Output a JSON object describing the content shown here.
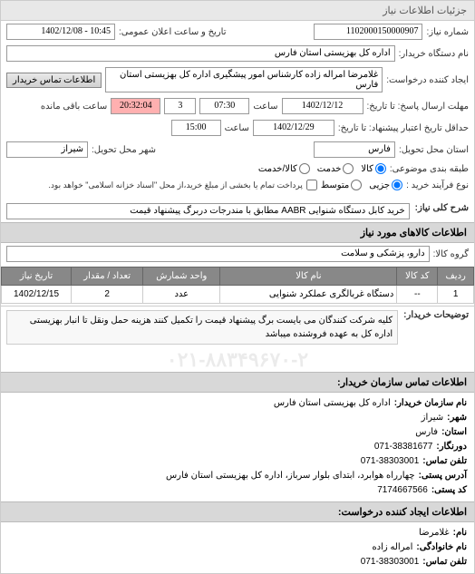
{
  "header": {
    "title": "جزئیات اطلاعات نیاز"
  },
  "form": {
    "needNumberLabel": "شماره نیاز:",
    "needNumber": "1102000150000907",
    "publicDateLabel": "تاریخ و ساعت اعلان عمومی:",
    "publicDate": "10:45 - 1402/12/08",
    "buyerOrgLabel": "نام دستگاه خریدار:",
    "buyerOrg": "اداره کل بهزیستی استان فارس",
    "requesterLabel": "ایجاد کننده درخواست:",
    "requester": "غلامرضا امراله زاده کارشناس امور پیشگیری اداره کل بهزیستی استان فارس",
    "contactBtn": "اطلاعات تماس خریدار",
    "deadlineLabel": "مهلت ارسال پاسخ: تا تاریخ:",
    "deadlineDate": "1402/12/12",
    "timeLabel": "ساعت",
    "deadlineTime": "07:30",
    "extCount": "3",
    "countdownLabel": "ساعت باقی مانده",
    "countdown": "20:32:04",
    "validityLabel": "حداقل تاریخ اعتبار پیشنهاد: تا تاریخ:",
    "validityDate": "1402/12/29",
    "validityTime": "15:00",
    "locationLabel": "استان محل تحویل:",
    "province": "فارس",
    "cityLabel": "شهر محل تحویل:",
    "city": "شیراز",
    "categoryLabel": "طبقه بندی موضوعی:",
    "catOptions": {
      "goods": "کالا",
      "service": "خدمت",
      "both": "کالا/خدمت"
    },
    "purchaseTypeLabel": "نوع فرآیند خرید :",
    "purchaseOptions": {
      "minor": "جزیی",
      "medium": "متوسط"
    },
    "paymentNote": "پرداخت تمام یا بخشی از مبلغ خرید،از محل \"اسناد خزانه اسلامی\" خواهد بود.",
    "mainDescLabel": "شرح کلی نیاز:",
    "mainDesc": "خرید کابل دستگاه شنوایی AABR مطابق با مندرجات دربرگ پیشنهاد قیمت"
  },
  "sections": {
    "itemsHeader": "اطلاعات کالاهای مورد نیاز",
    "groupLabel": "گروه کالا:",
    "groupValue": "دارو، پزشکی و سلامت",
    "contactHeader": "اطلاعات تماس سازمان خریدار:",
    "reqContactHeader": "اطلاعات ایجاد کننده درخواست:"
  },
  "table": {
    "headers": {
      "row": "ردیف",
      "code": "کد کالا",
      "name": "نام کالا",
      "unit": "واحد شمارش",
      "qty": "تعداد / مقدار",
      "date": "تاریخ نیاز"
    },
    "rows": [
      {
        "row": "1",
        "code": "--",
        "name": "دستگاه غربالگری عملکرد شنوایی",
        "unit": "عدد",
        "qty": "2",
        "date": "1402/12/15"
      }
    ]
  },
  "notes": {
    "label": "توضیحات خریدار:",
    "text": "کلیه شرکت کنندگان می بایست برگ پیشنهاد قیمت را تکمیل کنند هزینه حمل ونقل تا انبار بهزیستی اداره کل به عهده فروشنده میباشد"
  },
  "watermark": "۰۲۱-۸۸۳۴۹۶۷۰-۲",
  "contact": {
    "orgNameLabel": "نام سازمان خریدار:",
    "orgName": "اداره کل بهزیستی استان فارس",
    "cityLabel": "شهر:",
    "city": "شیراز",
    "provinceLabel": "استان:",
    "province": "فارس",
    "faxLabel": "دورنگار:",
    "fax": "071-38381677",
    "phoneLabel": "تلفن تماس:",
    "phone": "071-38303001",
    "addressLabel": "آدرس پستی:",
    "address": "چهارراه هوابرد، ابتدای بلوار سرباز، اداره کل بهزیستی استان فارس",
    "postalLabel": "کد پستی:",
    "postal": "7174667566",
    "reqNameLabel": "نام:",
    "reqName": "غلامرضا",
    "reqFamilyLabel": "نام خانوادگی:",
    "reqFamily": "امراله زاده",
    "reqPhoneLabel": "تلفن تماس:",
    "reqPhone": "071-38303001"
  }
}
